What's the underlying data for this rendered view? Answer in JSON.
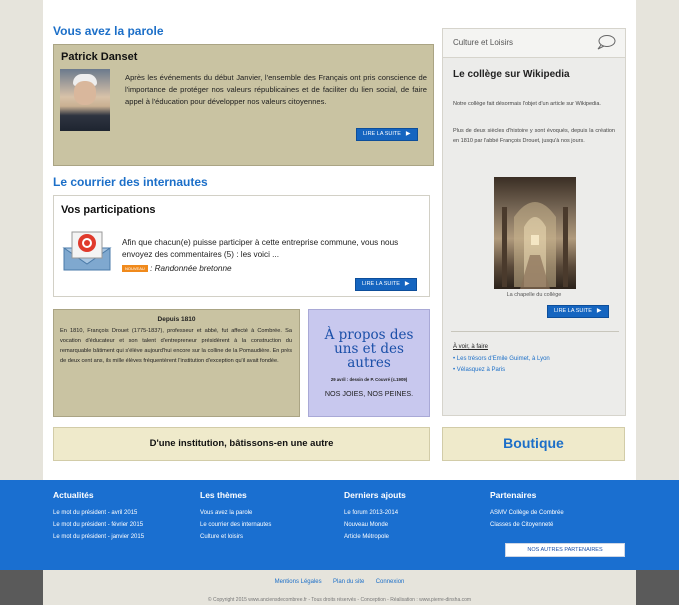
{
  "main": {
    "parole_title": "Vous avez la parole",
    "parole_name": "Patrick Danset",
    "parole_text": "Après les événements du début Janvier, l'ensemble des Français ont pris conscience de l'importance de protéger nos valeurs républicaines et de faciliter du lien social, de faire appel à l'éducation pour développer nos valeurs citoyennes.",
    "read_more": "LIRE LA SUITE",
    "courrier_title": "Le courrier des internautes",
    "participations_title": "Vos participations",
    "participations_text": "Afin que chacun(e) puisse participer à cette entreprise commune, vous nous envoyez des commentaires (5) : les voici ...",
    "participations_badge": "NOUVEAU",
    "participations_link": ": Randonnée bretonne",
    "depuis_title": "Depuis 1810",
    "depuis_text": "En 1810, François Drouet (1775-1837), professeur et abbé, fut affecté à Combrée. Sa vocation d'éducateur et son talent d'entrepreneur présidèrent à la construction du remarquable bâtiment qui s'élève aujourd'hui encore sur la colline de la Pomaudière. En près de deux cent ans, ils mille élèves fréquentèrent l'institution d'exception qu'il avait fondée.",
    "apropos_title": "À propos des uns et des autres",
    "apropos_sub": "29 avril : dessin de P. Couvré (c.1909)",
    "apropos_bottom": "NOS JOIES, NOS PEINES.",
    "institution_banner": "D'une institution, bâtissons-en une autre",
    "boutique_banner": "Boutique"
  },
  "side": {
    "category": "Culture et Loisirs",
    "title": "Le collège sur Wikipedia",
    "text1": "Notre collège fait désormais l'objet d'un article sur Wikipedia.",
    "text2": "Plus de deux siècles d'histoire y sont évoqués, depuis la création en 1810 par l'abbé François Drouet, jusqu'à nos jours.",
    "caption": "La chapelle du collège",
    "voir_title": "À voir, à faire",
    "voir_items": [
      "Les trésors d'Emile Guimet, à Lyon",
      "Vélasquez à Paris"
    ]
  },
  "footer": {
    "col1_title": "Actualités",
    "col1_items": [
      "Le mot du président - avril 2015",
      "Le mot du président - février 2015",
      "Le mot du président - janvier 2015"
    ],
    "col2_title": "Les thèmes",
    "col2_items": [
      "Vous avez la parole",
      "Le courrier des internautes",
      "Culture et loisirs"
    ],
    "col3_title": "Derniers ajouts",
    "col3_items": [
      "Le forum 2013-2014",
      "Nouveau Monde",
      "Article Métropole"
    ],
    "col4_title": "Partenaires",
    "col4_items": [
      "ASMV Collège de Combrée",
      "Classes de Citoyenneté"
    ],
    "partners_button": "NOS AUTRES PARTENAIRES"
  },
  "bottom": {
    "links": [
      "Mentions Légales",
      "Plan du site",
      "Connexion"
    ],
    "copyright": "© Copyright 2015 www.anciensdecombree.fr - Tous droits réservés - Conception - Réalisation : www.pierre-dinsha.com"
  },
  "colors": {
    "brand_blue": "#1a6fd0",
    "olive": "#c9c3a2",
    "lavender": "#c8c8ee",
    "cream": "#efeacb"
  }
}
